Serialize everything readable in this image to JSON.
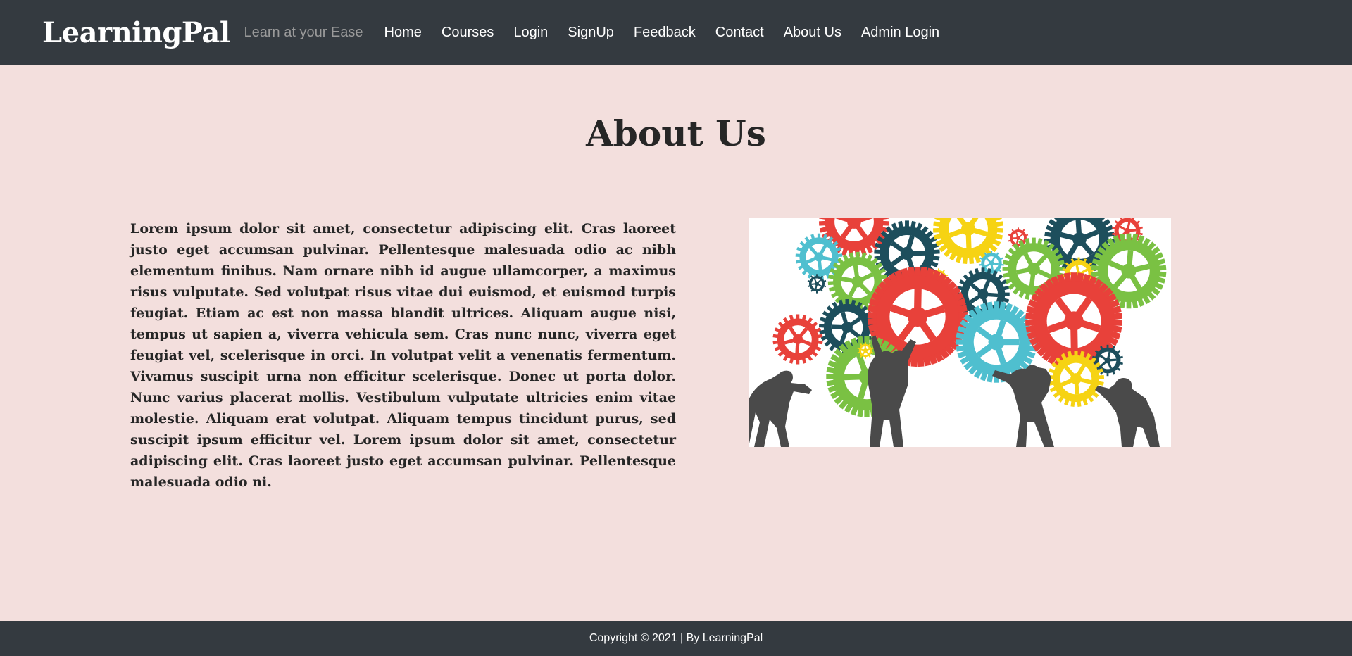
{
  "navbar": {
    "brand": "LearningPal",
    "tagline": "Learn at your Ease",
    "links": [
      "Home",
      "Courses",
      "Login",
      "SignUp",
      "Feedback",
      "Contact",
      "About Us",
      "Admin Login"
    ]
  },
  "main": {
    "title": "About Us",
    "paragraph": "Lorem ipsum dolor sit amet, consectetur adipiscing elit. Cras laoreet justo eget accumsan pulvinar. Pellentesque malesuada odio ac nibh elementum finibus. Nam ornare nibh id augue ullamcorper, a maximus risus vulputate. Sed volutpat risus vitae dui euismod, et euismod turpis feugiat. Etiam ac est non massa blandit ultrices. Aliquam augue nisi, tempus ut sapien a, viverra vehicula sem. Cras nunc nunc, viverra eget feugiat vel, scelerisque in orci. In volutpat velit a venenatis fermentum. Vivamus suscipit urna non efficitur scelerisque. Donec ut porta dolor. Nunc varius placerat mollis. Vestibulum vulputate ultricies enim vitae molestie. Aliquam erat volutpat. Aliquam tempus tincidunt purus, sed suscipit ipsum efficitur vel. Lorem ipsum dolor sit amet, consectetur adipiscing elit. Cras laoreet justo eget accumsan pulvinar. Pellentesque malesuada odio ni."
  },
  "footer": {
    "text": "Copyright © 2021 | By LearningPal"
  },
  "colors": {
    "navbar_bg": "#343a40",
    "page_bg": "#f3dfdd",
    "gear_red": "#e8413a",
    "gear_teal": "#1d4e5c",
    "gear_cyan": "#4fbfcf",
    "gear_green": "#7ac143",
    "gear_yellow": "#f6d313",
    "silhouette": "#4a4a4a"
  }
}
